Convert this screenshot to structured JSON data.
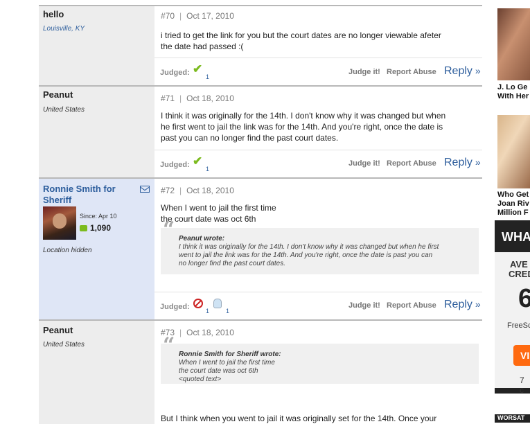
{
  "posts": [
    {
      "user": "hello",
      "location": "Louisville, KY",
      "number": "#70",
      "date": "Oct 17, 2010",
      "lines": [
        "i tried to get the link for you but the court dates are no longer viewable afeter",
        "the date had passed :("
      ],
      "judged_count": "1"
    },
    {
      "user": "Peanut",
      "location": "United States",
      "number": "#71",
      "date": "Oct 18, 2010",
      "lines": [
        "I think it was originally for the 14th. I don't know why it was changed but when",
        "he first went to jail the link was for the 14th. And you're right, once the date is",
        "past you can no longer find the past court dates."
      ],
      "judged_count": "1"
    },
    {
      "user": "Ronnie Smith for Sheriff",
      "since": "Since: Apr 10",
      "post_count": "1,090",
      "location": "Location hidden",
      "number": "#72",
      "date": "Oct 18, 2010",
      "lines": [
        "When I went to jail the first time",
        "the court date was oct 6th"
      ],
      "quote_author": "Peanut wrote:",
      "quote_lines": [
        "I think it was originally for the 14th. I don't know why it was changed but when he first",
        "went to jail the link was for the 14th. And you're right, once the date is past you can",
        "no longer find the past court dates."
      ],
      "judged_count_a": "1",
      "judged_count_b": "1"
    },
    {
      "user": "Peanut",
      "location": "United States",
      "number": "#73",
      "date": "Oct 18, 2010",
      "quote_author": "Ronnie Smith for Sheriff wrote:",
      "quote_lines": [
        "When I went to jail the first time",
        "the court date was oct 6th",
        "<quoted text>"
      ],
      "lines": [
        "But I think when you went to jail it was originally set for the 14th. Once your"
      ]
    }
  ],
  "actions": {
    "judged": "Judged:",
    "judge_it": "Judge it!",
    "report": "Report Abuse",
    "reply": "Reply",
    "reply_arrow": "»"
  },
  "ads": {
    "ad1_lines": [
      "J. Lo Ge",
      "With Her"
    ],
    "ad2_lines": [
      "Who Get",
      "Joan Riv",
      "Million F"
    ],
    "black_title": "WHA",
    "black_lines": [
      "AVE",
      "CRED",
      "6",
      "FreeSc",
      "VI",
      "7 c"
    ],
    "bottom": "WORSAT"
  }
}
